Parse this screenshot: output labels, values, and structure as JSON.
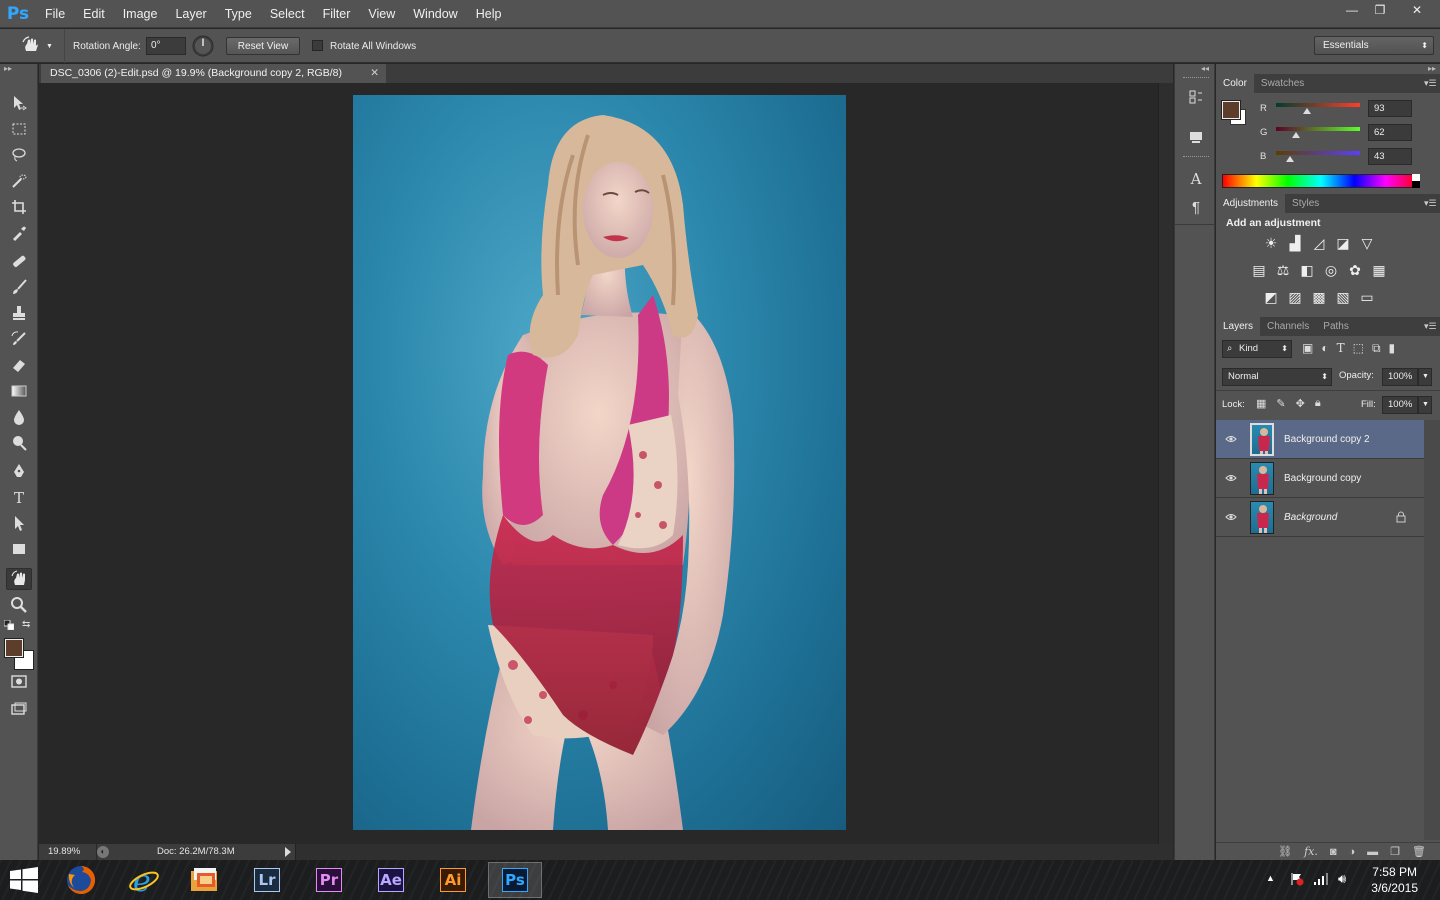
{
  "app": {
    "logo": "Ps"
  },
  "menu": [
    "File",
    "Edit",
    "Image",
    "Layer",
    "Type",
    "Select",
    "Filter",
    "View",
    "Window",
    "Help"
  ],
  "window_controls": {
    "minimize": "—",
    "restore": "❐",
    "close": "✕"
  },
  "options": {
    "rotation_label": "Rotation Angle:",
    "rotation_value": "0°",
    "reset_view": "Reset View",
    "rotate_all_label": "Rotate All Windows",
    "workspace": "Essentials"
  },
  "document": {
    "tab_title": "DSC_0306 (2)-Edit.psd @ 19.9% (Background copy 2, RGB/8)",
    "zoom": "19.89%",
    "doc_info": "Doc: 26.2M/78.3M"
  },
  "color_panel": {
    "tabs": [
      "Color",
      "Swatches"
    ],
    "fg_color": "#5d3e2b",
    "channels": [
      {
        "label": "R",
        "value": "93",
        "fraction": 0.365
      },
      {
        "label": "G",
        "value": "62",
        "fraction": 0.243
      },
      {
        "label": "B",
        "value": "43",
        "fraction": 0.169
      }
    ]
  },
  "adjustments_panel": {
    "tabs": [
      "Adjustments",
      "Styles"
    ],
    "heading": "Add an adjustment",
    "icons": [
      [
        "brightness-icon",
        "levels-icon",
        "curves-icon",
        "exposure-icon",
        "vibrance-icon"
      ],
      [
        "hue-saturation-icon",
        "color-balance-icon",
        "black-white-icon",
        "photo-filter-icon",
        "channel-mixer-icon",
        "color-lookup-icon"
      ],
      [
        "invert-icon",
        "posterize-icon",
        "threshold-icon",
        "gradient-map-icon",
        "selective-color-icon"
      ]
    ]
  },
  "layers_panel": {
    "tabs": [
      "Layers",
      "Channels",
      "Paths"
    ],
    "filter_kind": "Kind",
    "blend_mode": "Normal",
    "opacity_label": "Opacity:",
    "opacity_value": "100%",
    "lock_label": "Lock:",
    "fill_label": "Fill:",
    "fill_value": "100%",
    "layers": [
      {
        "name": "Background copy 2",
        "selected": true,
        "locked": false
      },
      {
        "name": "Background copy",
        "selected": false,
        "locked": false
      },
      {
        "name": "Background",
        "selected": false,
        "locked": true
      }
    ]
  },
  "taskbar": {
    "apps": [
      {
        "id": "firefox",
        "label": ""
      },
      {
        "id": "ie",
        "label": ""
      },
      {
        "id": "files",
        "label": ""
      },
      {
        "id": "lightroom",
        "label": "Lr",
        "color": "#a8c8ee",
        "bg": "#1a2a3f"
      },
      {
        "id": "premiere",
        "label": "Pr",
        "color": "#e08cf0",
        "bg": "#2a0f3a"
      },
      {
        "id": "aftereffects",
        "label": "Ae",
        "color": "#b9a8ff",
        "bg": "#1a1240"
      },
      {
        "id": "illustrator",
        "label": "Ai",
        "color": "#ff9a2e",
        "bg": "#3a1c05"
      },
      {
        "id": "photoshop",
        "label": "Ps",
        "color": "#31a8ff",
        "bg": "#0a1a33"
      }
    ],
    "time": "7:58 PM",
    "date": "3/6/2015"
  }
}
